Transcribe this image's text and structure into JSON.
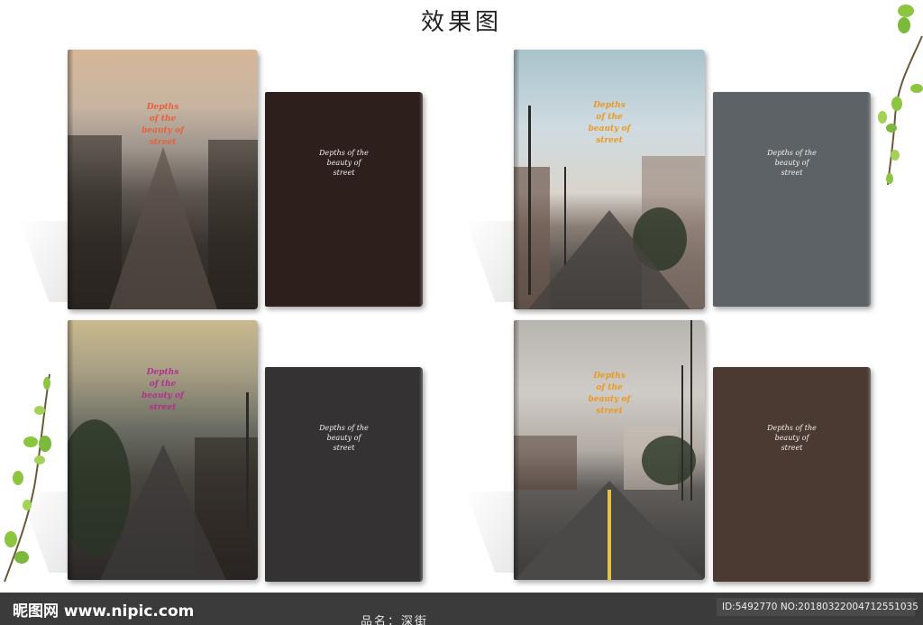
{
  "title": "效果图",
  "cover_text": {
    "front_lines": [
      "Depths",
      "of the",
      "beauty of",
      "street"
    ],
    "back_lines": [
      "Depths of the",
      "beauty of",
      "street"
    ]
  },
  "notebooks": [
    {
      "front_text_color": "#e8603a",
      "back_color": "#2c1f1c"
    },
    {
      "front_text_color": "#e99a22",
      "back_color": "#5c6266"
    },
    {
      "front_text_color": "#b2308e",
      "back_color": "#353234"
    },
    {
      "front_text_color": "#e99a22",
      "back_color": "#4a3a31"
    }
  ],
  "footer": {
    "logo": "昵图网 www.nipic.com",
    "product_name": "品名：深街",
    "id_text": "ID:5492770 NO:20180322004712551035"
  },
  "colors": {
    "leaf": "#8cc63f",
    "footer_bg": "#3b3b3b"
  }
}
